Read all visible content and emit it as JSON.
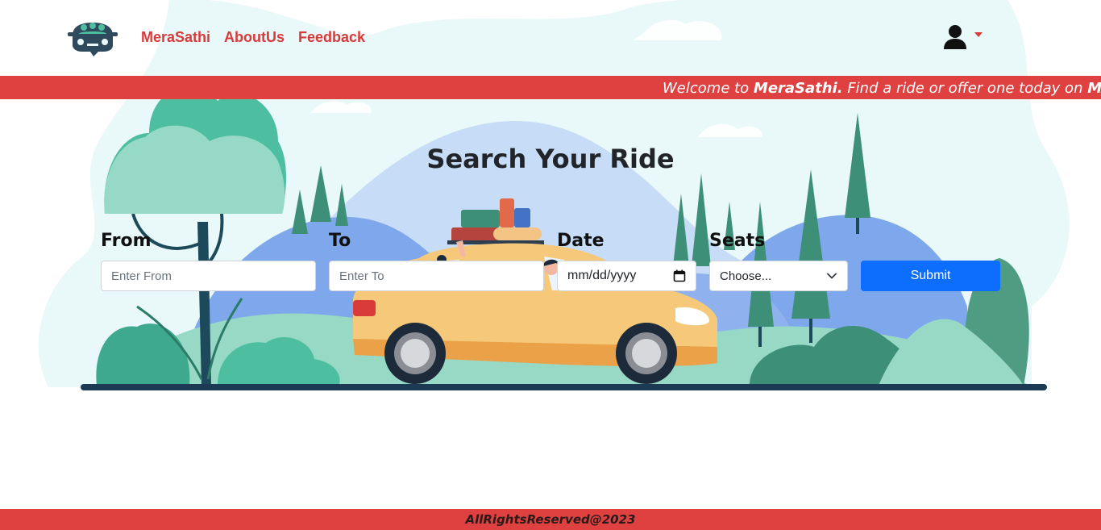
{
  "brand": {
    "logo_icon": "car-logo-icon",
    "accent_color": "#df4040",
    "nav_color": "#d93a3a"
  },
  "nav": {
    "links": [
      {
        "label": "MeraSathi"
      },
      {
        "label": "AboutUs"
      },
      {
        "label": "Feedback"
      }
    ],
    "user_icon": "user-icon",
    "dropdown_icon": "caret-down-icon"
  },
  "marquee": {
    "prefix": "Welcome to ",
    "brand1": "MeraSathi.",
    "middle": " Find a ride or offer one today on ",
    "brand2": "MeraSa"
  },
  "search": {
    "title": "Search Your Ride",
    "from_label": "From",
    "from_placeholder": "Enter From",
    "to_label": "To",
    "to_placeholder": "Enter To",
    "date_label": "Date",
    "date_placeholder": "mm/dd/yyyy",
    "seats_label": "Seats",
    "seats_selected": "Choose...",
    "submit_label": "Submit",
    "submit_color": "#0d6efd"
  },
  "footer": {
    "text": "AllRightsReserved@2023"
  }
}
